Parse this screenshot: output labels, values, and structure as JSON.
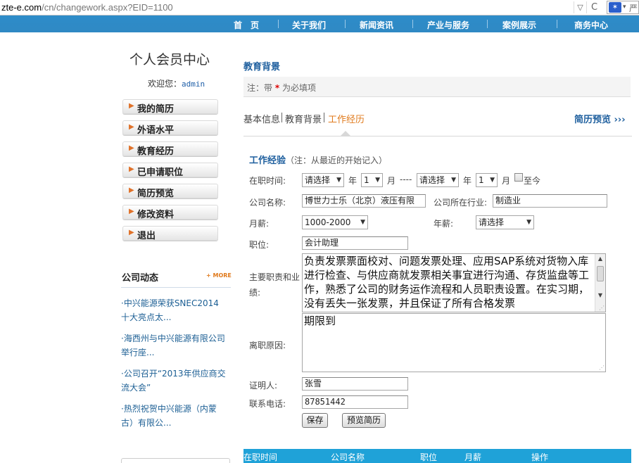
{
  "browser": {
    "url_host": "zte-e.com",
    "url_path": "/cn/changework.aspx?EID=1100",
    "dropdown_icon": "▽",
    "reload_icon": "C",
    "search_text": "严"
  },
  "nav": [
    "首　页",
    "关于我们",
    "新闻资讯",
    "产业与服务",
    "案例展示",
    "商务中心"
  ],
  "sidebar": {
    "title": "个人会员中心",
    "welcome_label": "欢迎您：",
    "username": "admin",
    "menu": [
      "我的简历",
      "外语水平",
      "教育经历",
      "已申请职位",
      "简历预览",
      "修改资料",
      "退出"
    ]
  },
  "news": {
    "title": "公司动态",
    "more": "+ MORE",
    "items": [
      "·中兴能源荣获SNEC2014十大亮点太...",
      "·海西州与中兴能源有限公司举行座...",
      "·公司召开“2013年供应商交流大会”",
      "·热烈祝贺中兴能源（内蒙古）有限公..."
    ]
  },
  "main": {
    "section_title": "教育背景",
    "hint_prefix": "注：带",
    "hint_star": "*",
    "hint_suffix": "为必填项",
    "tabs": [
      "基本信息",
      "教育背景",
      "工作经历"
    ],
    "preview_link": "简历预览 ›››"
  },
  "form": {
    "title": "工作经验",
    "title_note": "（注：从最近的开始记入）",
    "period_label": "在职时间:",
    "start_year": "请选择",
    "year_label": "年",
    "start_month": "1",
    "month_label": "月",
    "dash": "----",
    "end_year": "请选择",
    "end_month": "1",
    "until_now": "至今",
    "company_label": "公司名称:",
    "company_value": "博世力士乐（北京）液压有限",
    "industry_label": "公司所在行业:",
    "industry_value": "制造业",
    "salary_label": "月薪:",
    "salary_value": "1000-2000",
    "annual_label": "年薪:",
    "annual_value": "请选择",
    "position_label": "职位:",
    "position_value": "会计助理",
    "duties_label_1": "主要职责和业",
    "duties_label_2": "绩:",
    "duties_text": "负责发票票面校对、问题发票处理、应用SAP系统对货物入库进行检查、与供应商就发票相关事宜进行沟通、存货监盘等工作，熟悉了公司的财务运作流程和人员职责设置。在实习期，没有丢失一张发票，并且保证了所有合格发票",
    "leave_label": "离职原因:",
    "leave_text": "期限到",
    "reference_label": "证明人:",
    "reference_value": "张雪",
    "phone_label": "联系电话:",
    "phone_value": "87851442",
    "save_button": "保存",
    "preview_button": "预览简历"
  },
  "table": {
    "headers": [
      "在职时间",
      "公司名称",
      "职位",
      "月薪",
      "操作"
    ]
  },
  "colors": {
    "nav_blue": "#2e8cc9",
    "link_blue": "#1e5f9e",
    "accent_orange": "#e07a1c",
    "table_header": "#1fa2d8"
  }
}
